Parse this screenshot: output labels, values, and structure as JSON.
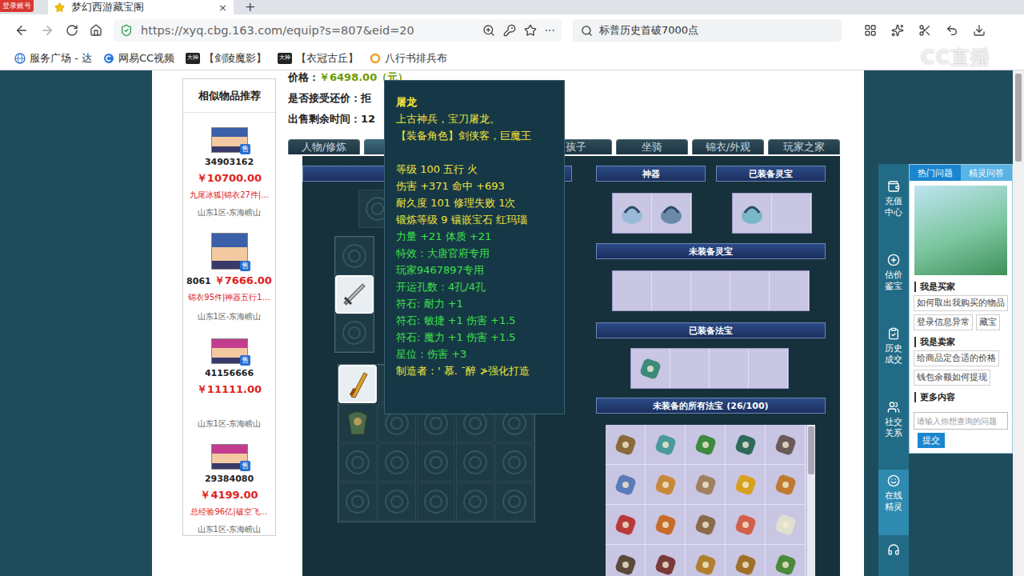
{
  "browser": {
    "badge": "登录账号",
    "tab": {
      "title": "梦幻西游藏宝阁",
      "close": "×",
      "selected": true
    },
    "newTab": "+",
    "url": "https://xyq.cbg.163.com/equip?s=807&eid=20",
    "more": "···",
    "search": "标普历史首破7000点",
    "bookmarks": [
      {
        "label": "服务广场 - 达",
        "kind": "globe",
        "badge": ""
      },
      {
        "label": "网易CC视频",
        "kind": "cc",
        "badge": ""
      },
      {
        "label": "【剑陵魔影】",
        "kind": "dashen",
        "badge": "大神"
      },
      {
        "label": "【衣冠古丘】",
        "kind": "dashen",
        "badge": "大神"
      },
      {
        "label": "八行书排兵布",
        "kind": "ring",
        "badge": ""
      }
    ],
    "watermark": "CC直播"
  },
  "similar": {
    "title": "相似物品推荐",
    "badge": "售",
    "items": [
      {
        "id": "34903162",
        "price": "￥10700.00",
        "tags": "九尾冰狐|锦衣27件|…",
        "server": "山东1区-东海崂山",
        "kind": "stacked",
        "color": "#3b5fa8"
      },
      {
        "id": "8061",
        "price": "￥7666.00",
        "tags": "锦衣95件|神器五行1…",
        "server": "山东1区-东海崂山",
        "kind": "inline",
        "color": "#3b5fa8"
      },
      {
        "id": "41156666",
        "price": "￥11111.00",
        "tags": "",
        "server": "山东1区-东海崂山",
        "kind": "stacked",
        "color": "#c23d8e"
      },
      {
        "id": "29384080",
        "price": "￥4199.00",
        "tags": "总经验96亿|破空飞…",
        "server": "山东1区-东海崂山",
        "kind": "stacked",
        "color": "#c23d8e"
      }
    ]
  },
  "info": [
    {
      "label": "价格：",
      "value": "￥6498.00（元）"
    },
    {
      "label": "是否接受还价：",
      "value": "拒"
    },
    {
      "label": "出售剩余时间：",
      "value": "12"
    }
  ],
  "tabs": [
    {
      "label": "人物/修炼",
      "selected": false
    },
    {
      "label": "",
      "selected": true
    },
    {
      "label": "孩子",
      "selected": false
    },
    {
      "label": "坐骑",
      "selected": false
    },
    {
      "label": "锦衣/外观",
      "selected": false
    },
    {
      "label": "玩家之家",
      "selected": false
    }
  ],
  "equipment": {
    "slots": [
      {
        "filled": false,
        "selected": false
      },
      {
        "filled": false,
        "selected": false
      },
      {
        "filled": true,
        "selected": true
      },
      {
        "filled": false,
        "selected": false
      }
    ],
    "bag": [
      {
        "filled": true,
        "selected": true
      },
      {
        "filled": true,
        "selected": false
      },
      {
        "filled": false,
        "selected": false
      },
      {
        "filled": false,
        "selected": false
      },
      {
        "filled": false,
        "selected": false
      },
      {
        "filled": true,
        "selected": false
      },
      {
        "filled": false,
        "selected": false
      },
      {
        "filled": false,
        "selected": false
      },
      {
        "filled": false,
        "selected": false
      },
      {
        "filled": false,
        "selected": false
      },
      {
        "filled": false,
        "selected": false
      },
      {
        "filled": false,
        "selected": false
      },
      {
        "filled": false,
        "selected": false
      },
      {
        "filled": false,
        "selected": false
      },
      {
        "filled": false,
        "selected": false
      },
      {
        "filled": false,
        "selected": false
      },
      {
        "filled": false,
        "selected": false
      },
      {
        "filled": false,
        "selected": false
      },
      {
        "filled": false,
        "selected": false
      },
      {
        "filled": false,
        "selected": false
      }
    ]
  },
  "artifact": {
    "header": "神器",
    "cells": [
      {
        "filled": true
      },
      {
        "filled": true
      }
    ]
  },
  "lingbao": {
    "equippedHeader": "已装备灵宝",
    "equipped": [
      {
        "filled": true
      },
      {
        "filled": false
      }
    ],
    "unequippedHeader": "未装备灵宝",
    "unequipped": [
      {
        "filled": false
      },
      {
        "filled": false
      },
      {
        "filled": false
      },
      {
        "filled": false
      },
      {
        "filled": false
      }
    ]
  },
  "fabao": {
    "equippedHeader": "已装备法宝",
    "equipped": [
      {
        "filled": true
      },
      {
        "filled": false
      },
      {
        "filled": false
      },
      {
        "filled": false
      }
    ],
    "allHeader": "未装备的所有法宝 (26/100)",
    "all": [
      {
        "filled": true
      },
      {
        "filled": true
      },
      {
        "filled": true
      },
      {
        "filled": true
      },
      {
        "filled": true
      },
      {
        "filled": true
      },
      {
        "filled": true
      },
      {
        "filled": true
      },
      {
        "filled": true
      },
      {
        "filled": true
      },
      {
        "filled": true
      },
      {
        "filled": true
      },
      {
        "filled": true
      },
      {
        "filled": true
      },
      {
        "filled": true
      },
      {
        "filled": true
      },
      {
        "filled": true
      },
      {
        "filled": true
      },
      {
        "filled": true
      },
      {
        "filled": true
      }
    ]
  },
  "tooltip": {
    "title": "屠龙",
    "lines": [
      {
        "text": "上古神兵，宝刀屠龙。",
        "color": "#f2e33c"
      },
      {
        "text": "【装备角色】剑侠客，巨魔王",
        "color": "#f2e33c"
      },
      {
        "text": "",
        "color": "#f2e33c"
      },
      {
        "text": "等级 100 五行 火",
        "color": "#f2e33c"
      },
      {
        "text": "伤害 +371 命中 +693",
        "color": "#f2e33c"
      },
      {
        "text": "耐久度 101 修理失败 1次",
        "color": "#f2e33c"
      },
      {
        "text": "锻炼等级 9 镶嵌宝石 红玛瑙",
        "color": "#f2e33c"
      },
      {
        "text": "力量 +21 体质 +21",
        "color": "#3de048"
      },
      {
        "text": "特效：大唐官府专用",
        "color": "#3de048"
      },
      {
        "text": "玩家9467897专用",
        "color": "#3de048"
      },
      {
        "text": "开运孔数：4孔/4孔",
        "color": "#3de048"
      },
      {
        "text": "符石: 耐力 +1",
        "color": "#3de048"
      },
      {
        "text": "符石: 敏捷 +1 伤害 +1.5",
        "color": "#3de048"
      },
      {
        "text": "符石: 魔力 +1 伤害 +1.5",
        "color": "#3de048"
      },
      {
        "text": "星位：伤害 +3",
        "color": "#3de048"
      },
      {
        "text": "制造者：' 慕. ˉ醉 ≯强化打造",
        "color": "#f2e33c"
      }
    ]
  },
  "sideNav": [
    {
      "label": "充值中心",
      "selected": false
    },
    {
      "label": "估价鉴宝",
      "selected": false
    },
    {
      "label": "历史成交",
      "selected": false
    },
    {
      "label": "社交关系",
      "selected": false
    },
    {
      "label": "在线精灵",
      "selected": true
    }
  ],
  "help": {
    "tabs": [
      {
        "label": "热门问题",
        "selected": true
      },
      {
        "label": "精灵问答",
        "selected": false
      }
    ],
    "buyer": "我是买家",
    "buyerLinks": [
      "如何取出我购买的物品",
      "登录信息异常",
      "藏宝"
    ],
    "seller": "我是卖家",
    "sellerLinks": [
      "给商品定合适的价格",
      "钱包余额如何提现"
    ],
    "more": "更多内容",
    "placeholder": "请输入你想查询的问题",
    "submit": "提交"
  }
}
